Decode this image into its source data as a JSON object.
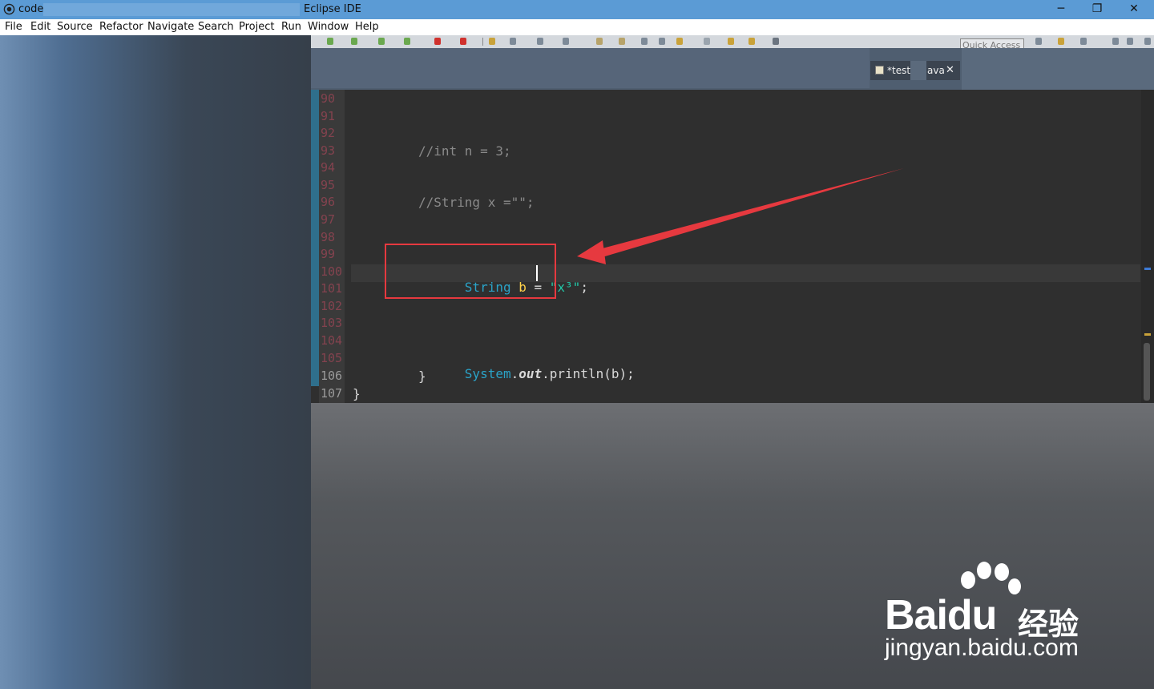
{
  "titlebar": {
    "workspace": "code",
    "app_title": "Eclipse IDE",
    "minimize": "─",
    "restore": "❐",
    "close": "✕"
  },
  "menu": [
    "File",
    "Edit",
    "Source",
    "Refactor",
    "Navigate",
    "Search",
    "Project",
    "Run",
    "Window",
    "Help"
  ],
  "toolbar": {
    "quick_access": "Quick Access"
  },
  "editor_tab": {
    "label_start": "*test",
    "label_end": "ava",
    "close": "✕"
  },
  "gutter": [
    "90",
    "91",
    "92",
    "93",
    "94",
    "95",
    "96",
    "97",
    "98",
    "99",
    "100",
    "101",
    "102",
    "103",
    "104",
    "105",
    "106",
    "107"
  ],
  "code": {
    "line_93": "//int n = 3;",
    "line_96": "//String x =\"\";",
    "line_100_type": "String",
    "line_100_var": "b",
    "line_100_eq": " = ",
    "line_100_str": "\"x³\"",
    "line_100_end": ";",
    "line_105_type": "System",
    "line_105_dot1": ".",
    "line_105_field": "out",
    "line_105_rest": ".println(b);",
    "line_106": "}",
    "line_107": "}"
  },
  "watermark": {
    "brand": "Bai",
    "brand2": "du",
    "cn": "经验",
    "url": "jingyan.baidu.com"
  },
  "colors": {
    "titlebar": "#5b9bd5",
    "editor_bg": "#2f2f2f",
    "annotation": "#e6393f",
    "keyword_type": "#2aa3c8",
    "variable": "#ffd24a",
    "string": "#22c8a8"
  }
}
